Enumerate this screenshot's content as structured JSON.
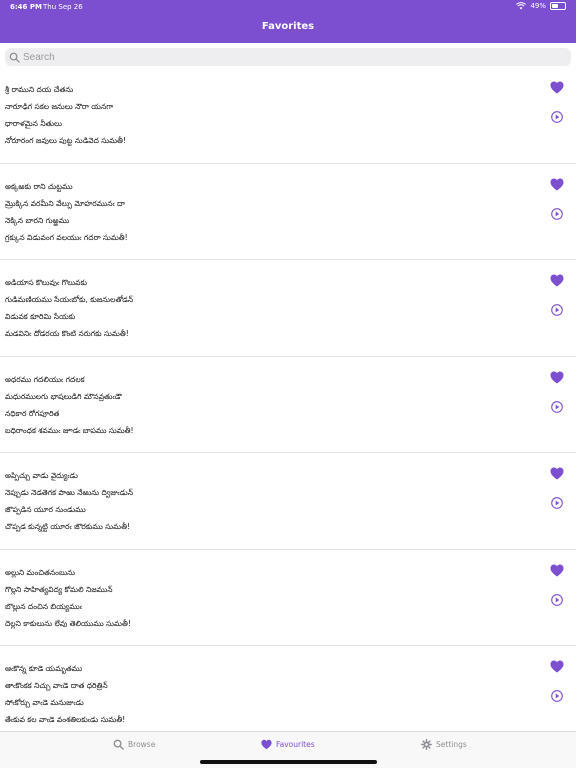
{
  "status_bar": {
    "time": "6:46 PM",
    "date": "Thu Sep 26",
    "battery_text": "49%",
    "battery_level": 0.49,
    "wifi_icon": "wifi-icon",
    "battery_icon": "battery-icon"
  },
  "nav": {
    "title": "Favorites"
  },
  "search": {
    "placeholder": "Search",
    "icon": "search-icon"
  },
  "colors": {
    "accent": "#7b4fcf",
    "header_bg": "#7b4fcf",
    "tab_inactive": "#8e8e93",
    "divider": "#e3e3e6"
  },
  "poems": [
    {
      "lines": [
        "శ్రీ రాముని దయ చేతను",
        "నారూఢిగ సకల జనులు నౌరా యనగా",
        "ధారాళమైన నీతులు",
        "నోరూరంగ జవులు పుట్ట నుడివెద సుమతీ!"
      ]
    },
    {
      "lines": [
        "అక్కఱకు రాని చుట్టము",
        "మ్రొక్కిన వరమీని వేల్పు మోహరమునఁ దా",
        "నెక్కిన బారని గుఱ్ఱము",
        "గ్రక్కున విడువంగ వలయుఁ గదరా సుమతీ!"
      ]
    },
    {
      "lines": [
        "అడియాస కొలువుఁ గొలువకు",
        "గుడిమణియము సేయఁబోకు, కుజనులతోడన్",
        "విడువక కూరిమి సేయకు",
        "మడవినిఁ దోడరయ కొంటి నరుగకు సుమతీ!"
      ]
    },
    {
      "lines": [
        "అధరము గదలియుఁ గదలక",
        "మధురములగు భాషలుడిగి మౌనవ్రతుఁడౌ",
        "నధికార రోగపూరిత",
        "బధిరాంధక శవముఁ జూడఁ బాపము సుమతీ!"
      ]
    },
    {
      "lines": [
        "అప్పిచ్చు వాడు వైద్యుఁడు",
        "నెప్పుడు నెడతెగక పాఱు నేఱును ద్విజుఁడున్",
        "జొప్పడిన యూర నుండుము",
        "చొప్పడ కున్నట్టి యూరఁ జొరకుము సుమతీ!"
      ]
    },
    {
      "lines": [
        "అల్లుని మంచితనంబును",
        "గొల్లని సాహిత్యవిద్య కోమలి నిజమున్",
        "బొల్లున దంచిన బియ్యముఁ",
        "దెల్లని కాకులును లేవు తెలియుము సుమతీ!"
      ]
    },
    {
      "lines": [
        "ఆఁకొన్న కూడె యమృతము",
        "తాఁకొంకక నిచ్చు వాఁడె దాత ధరిత్రిన్",
        "సోఁకోర్చు వాఁడె మనుజుఁడు",
        "తేఁకువ కల వాఁడె వంశతిలకుఁడు సుమతీ!"
      ]
    }
  ],
  "row_icons": {
    "favorite": "heart-icon",
    "play": "play-circle-icon"
  },
  "tabs": [
    {
      "label": "Browse",
      "icon": "search-icon",
      "selected": false
    },
    {
      "label": "Favourites",
      "icon": "heart-icon",
      "selected": true
    },
    {
      "label": "Settings",
      "icon": "gear-icon",
      "selected": false
    }
  ]
}
